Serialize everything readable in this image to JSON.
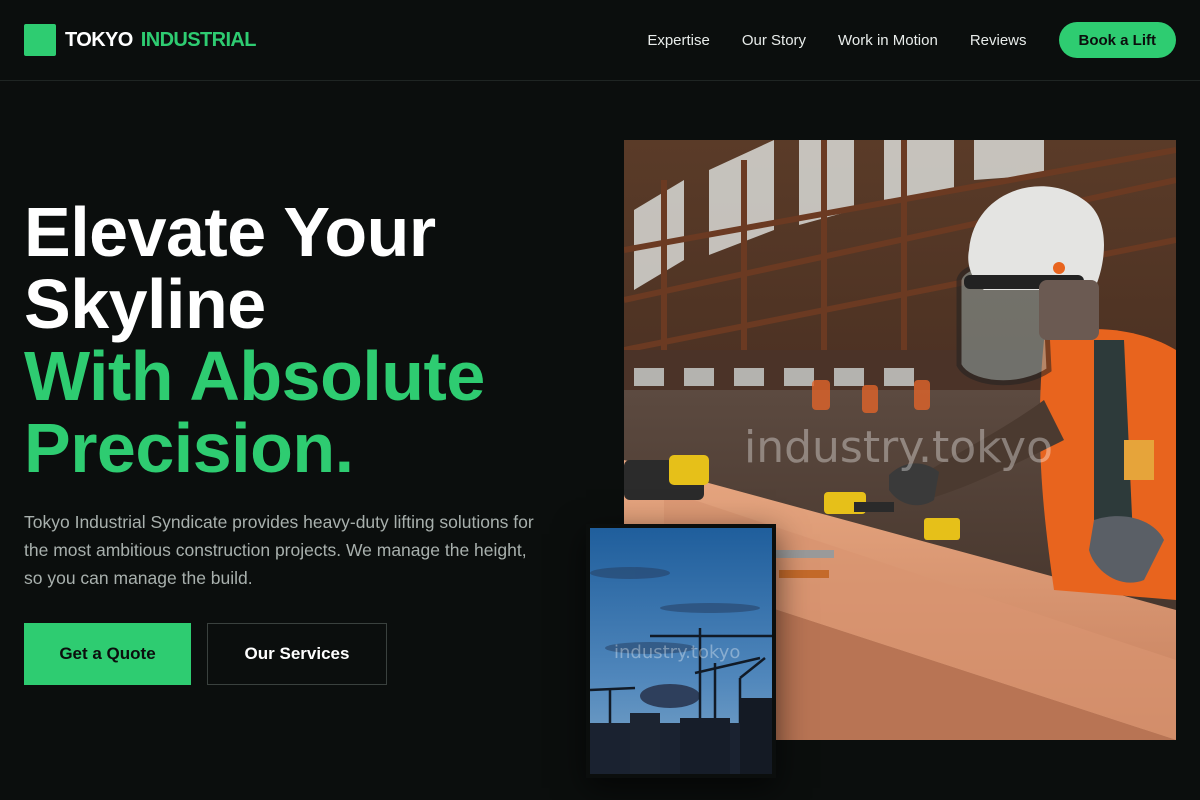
{
  "brand": {
    "name": "TOKYO",
    "accent": "INDUSTRIAL",
    "accent_color": "#2ecc71"
  },
  "nav": {
    "links": [
      "Expertise",
      "Our Story",
      "Work in Motion",
      "Reviews"
    ],
    "cta": "Book a Lift"
  },
  "hero": {
    "title_lines": [
      "Elevate Your",
      "Skyline"
    ],
    "accent_lines": [
      "With Absolute",
      "Precision."
    ],
    "description": "Tokyo Industrial Syndicate provides heavy-duty lifting solutions for the most ambitious construction projects. We manage the height, so you can manage the build.",
    "primary_button": "Get a Quote",
    "secondary_button": "Our Services"
  },
  "images": {
    "main_watermark": "industry.tokyo",
    "small_watermark": "industry.tokyo"
  },
  "colors": {
    "background": "#0b0e0d",
    "accent": "#2ecc71",
    "muted_text": "#a8b0ad"
  }
}
